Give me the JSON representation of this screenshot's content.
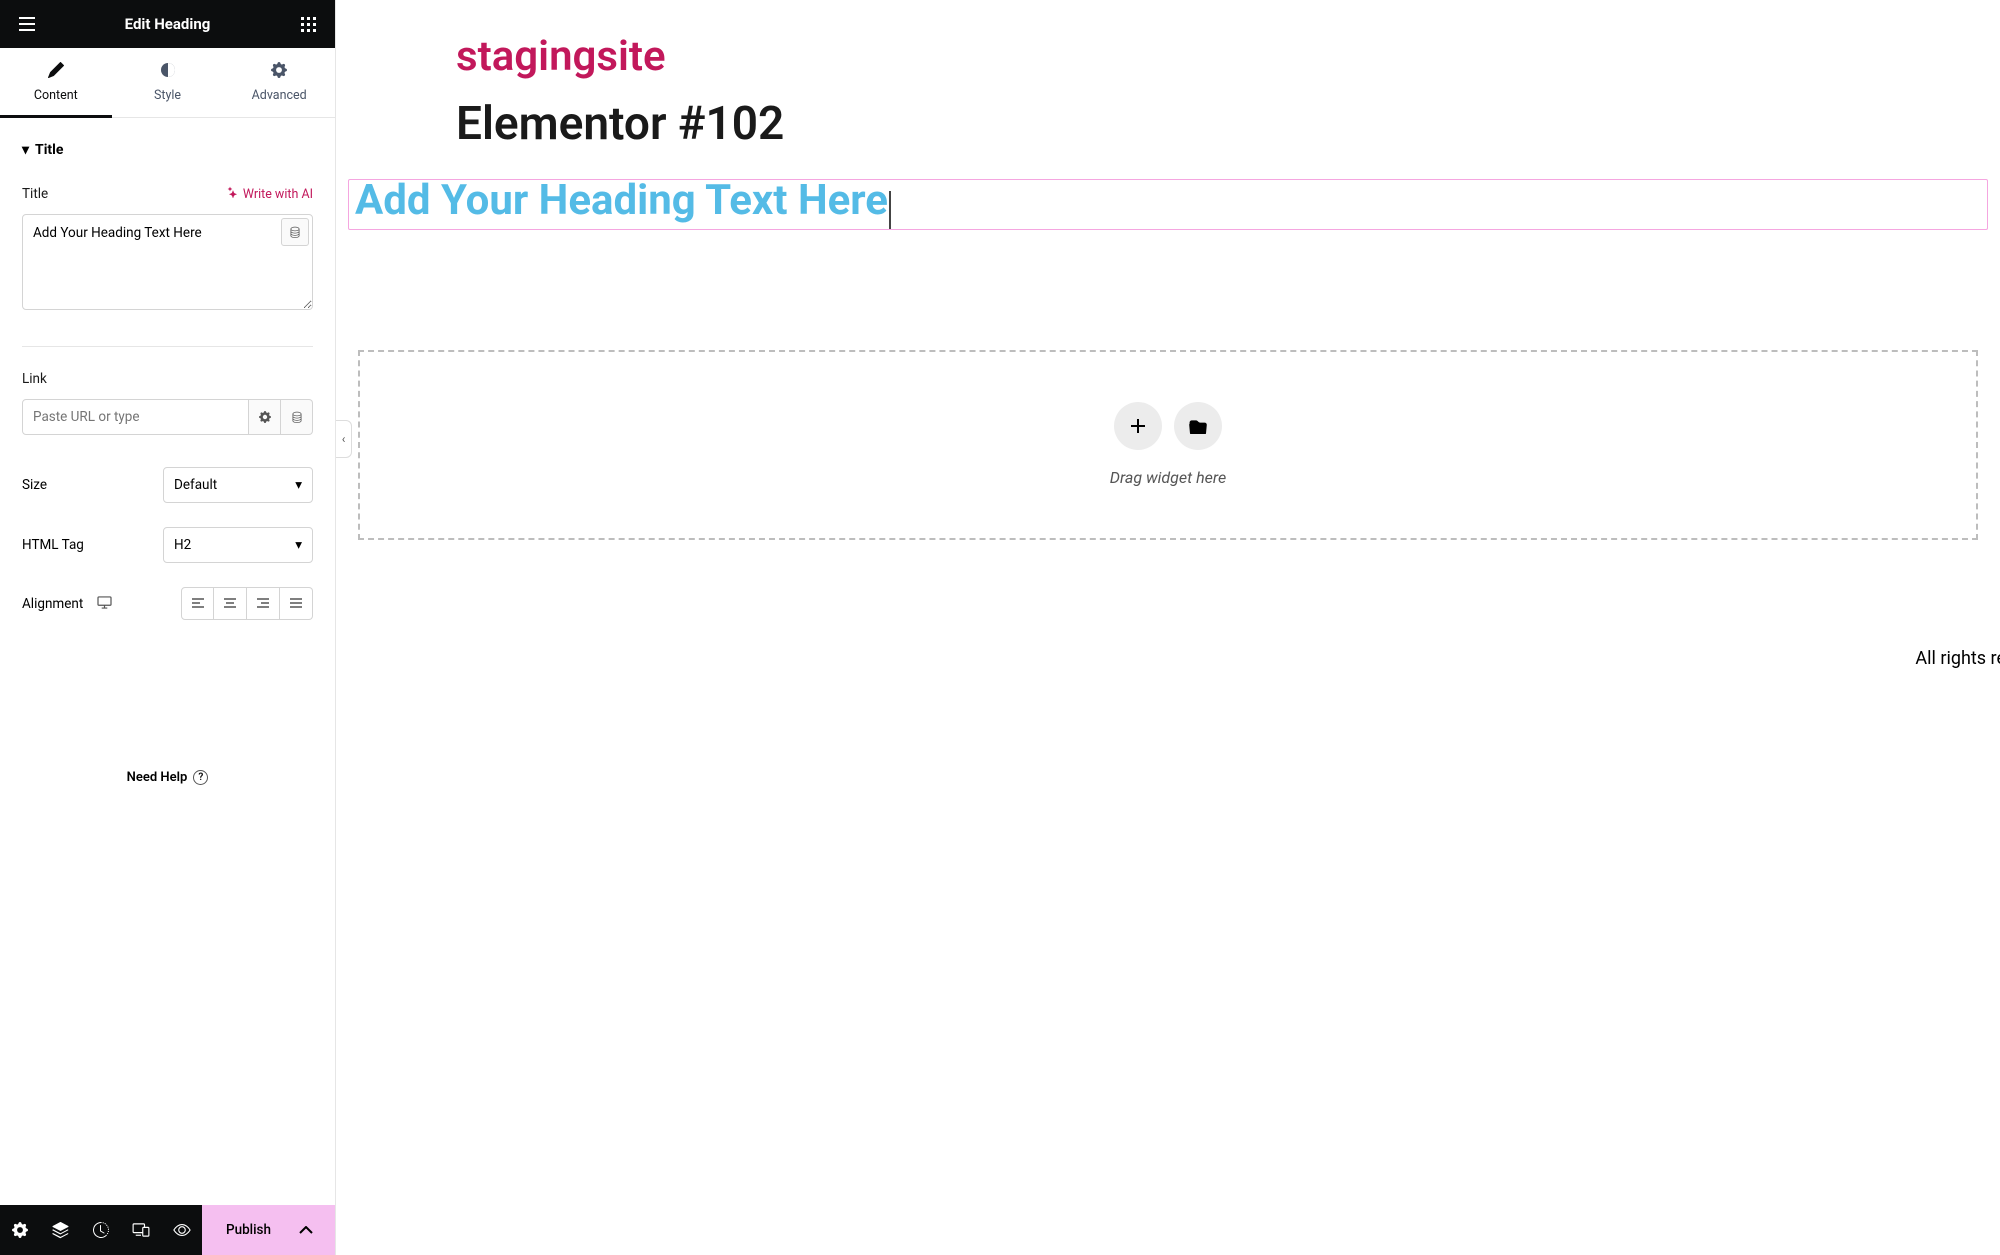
{
  "header": {
    "title": "Edit Heading"
  },
  "tabs": {
    "content": "Content",
    "style": "Style",
    "advanced": "Advanced"
  },
  "section": {
    "title": "Title"
  },
  "fields": {
    "title_label": "Title",
    "write_ai": "Write with AI",
    "title_value": "Add Your Heading Text Here",
    "link_label": "Link",
    "link_placeholder": "Paste URL or type",
    "size_label": "Size",
    "size_value": "Default",
    "tag_label": "HTML Tag",
    "tag_value": "H2",
    "align_label": "Alignment"
  },
  "help": "Need Help",
  "footer": {
    "publish": "Publish"
  },
  "canvas": {
    "site": "stagingsite",
    "page": "Elementor #102",
    "heading": "Add Your Heading Text Here",
    "drop": "Drag widget here",
    "rights": "All rights re"
  }
}
